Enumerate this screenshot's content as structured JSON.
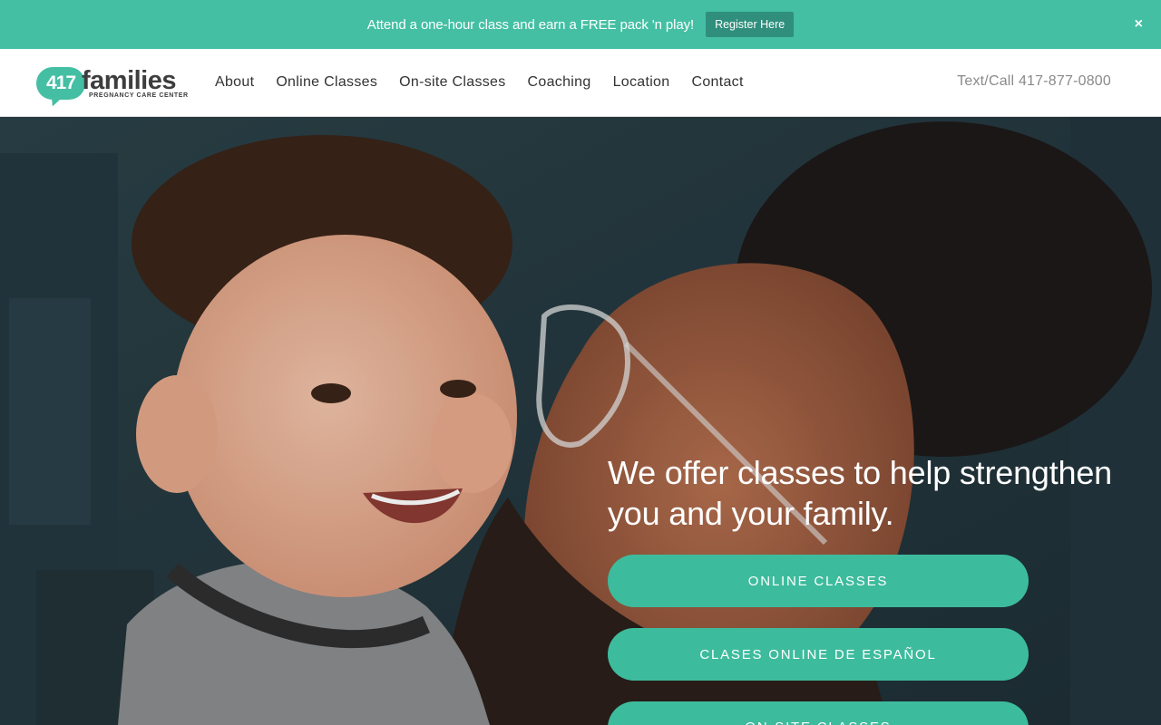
{
  "announcement": {
    "text": "Attend a one-hour class and earn a FREE pack 'n play!",
    "button_label": "Register Here",
    "close_label": "×"
  },
  "header": {
    "logo": {
      "number": "417",
      "word": "families",
      "tagline": "PREGNANCY CARE CENTER"
    },
    "nav": [
      "About",
      "Online Classes",
      "On-site Classes",
      "Coaching",
      "Location",
      "Contact"
    ],
    "phone": "Text/Call 417-877-0800"
  },
  "hero": {
    "headline": "We offer classes to help strengthen you and your family.",
    "buttons": [
      "ONLINE CLASSES",
      "CLASES ONLINE DE ESPAÑOL",
      "ON-SITE CLASSES"
    ]
  },
  "colors": {
    "accent": "#44bfa3",
    "button": "#3dbb9d",
    "register_button": "#2f8f7c",
    "hero_background": "#243942"
  }
}
